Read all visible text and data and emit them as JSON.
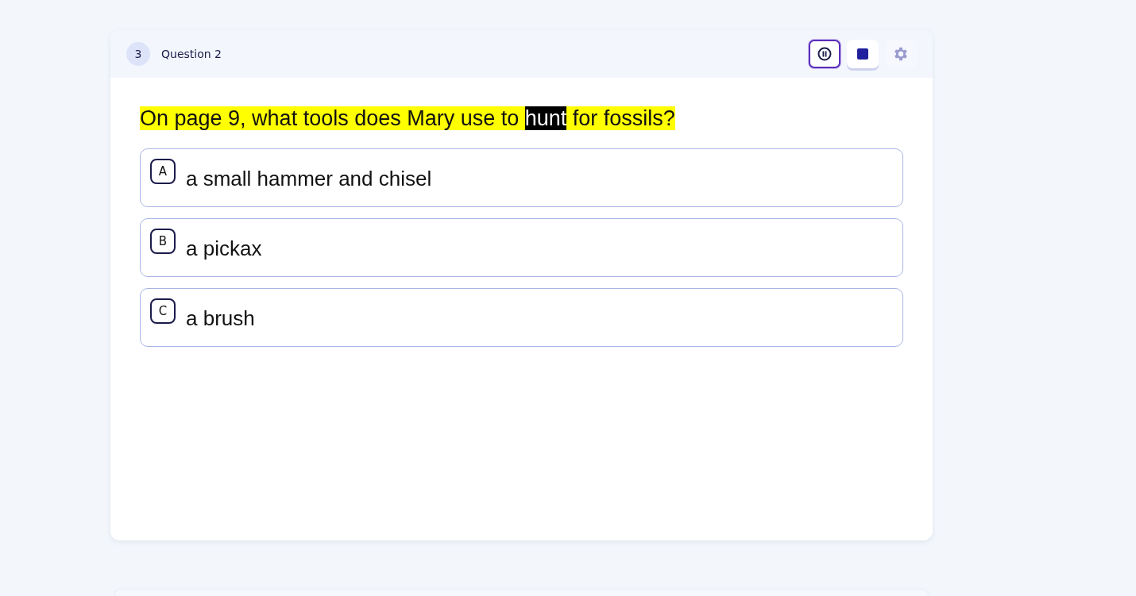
{
  "header": {
    "number": "3",
    "title": "Question 2"
  },
  "controls": [
    {
      "kind": "pause",
      "focused": true
    },
    {
      "kind": "stop",
      "focused": false
    },
    {
      "kind": "settings",
      "focused": false
    }
  ],
  "question": [
    {
      "text": "On page 9, what tools does Mary use to ",
      "selected": false
    },
    {
      "text": "hunt",
      "selected": true
    },
    {
      "text": " for fossils?",
      "selected": false
    }
  ],
  "options": [
    {
      "letter": "A",
      "text": "a small hammer and chisel"
    },
    {
      "letter": "B",
      "text": "a pickax"
    },
    {
      "letter": "C",
      "text": "a brush"
    }
  ]
}
